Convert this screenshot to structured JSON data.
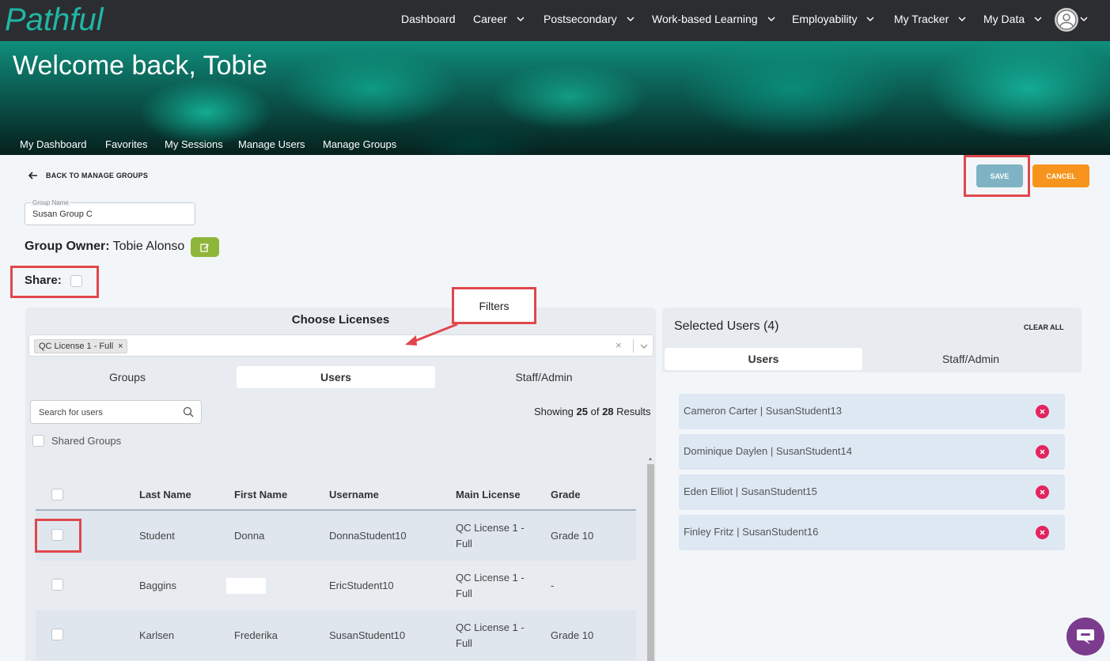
{
  "brand": {
    "logo_text": "Pathful",
    "logo_color": "#1fb7a4"
  },
  "topnav": {
    "items": [
      {
        "label": "Dashboard",
        "has_menu": false
      },
      {
        "label": "Career",
        "has_menu": true
      },
      {
        "label": "Postsecondary",
        "has_menu": true
      },
      {
        "label": "Work-based Learning",
        "has_menu": true
      },
      {
        "label": "Employability",
        "has_menu": true
      },
      {
        "label": "My Tracker",
        "has_menu": true
      },
      {
        "label": "My Data",
        "has_menu": true
      }
    ]
  },
  "hero": {
    "title": "Welcome back, Tobie"
  },
  "subnav": {
    "items": [
      "My Dashboard",
      "Favorites",
      "My Sessions",
      "Manage Users",
      "Manage Groups"
    ]
  },
  "actions": {
    "back_label": "BACK TO MANAGE GROUPS",
    "save_label": "SAVE",
    "cancel_label": "CANCEL"
  },
  "group": {
    "name_label": "Group Name",
    "name_value": "Susan Group C",
    "owner_label": "Group Owner:",
    "owner_value": "Tobie Alonso",
    "share_label": "Share:"
  },
  "licenses": {
    "title": "Choose Licenses",
    "selected_chip": "QC License 1 - Full",
    "tabs": [
      "Groups",
      "Users",
      "Staff/Admin"
    ],
    "active_tab": "Users",
    "search_placeholder": "Search for users",
    "showing_prefix": "Showing",
    "showing_count": "25",
    "showing_of": "of",
    "showing_total": "28",
    "showing_suffix": "Results",
    "shared_groups_label": "Shared Groups",
    "columns": [
      "Last Name",
      "First Name",
      "Username",
      "Main License",
      "Grade"
    ],
    "rows": [
      {
        "last": "Student",
        "first": "Donna",
        "username": "DonnaStudent10",
        "license_l1": "QC License 1 -",
        "license_l2": "Full",
        "grade": "Grade 10"
      },
      {
        "last": "Baggins",
        "first": "",
        "username": "EricStudent10",
        "license_l1": "QC License 1 -",
        "license_l2": "Full",
        "grade": "-"
      },
      {
        "last": "Karlsen",
        "first": "Frederika",
        "username": "SusanStudent10",
        "license_l1": "QC License 1 -",
        "license_l2": "Full",
        "grade": "Grade 10"
      }
    ]
  },
  "selected": {
    "title": "Selected Users (4)",
    "clear_all": "CLEAR ALL",
    "tabs": [
      "Users",
      "Staff/Admin"
    ],
    "active_tab": "Users",
    "users": [
      "Cameron Carter | SusanStudent13",
      "Dominique Daylen | SusanStudent14",
      "Eden Elliot | SusanStudent15",
      "Finley Fritz | SusanStudent16"
    ]
  },
  "annotation": {
    "callout_label": "Filters",
    "highlight_color": "#e0474c"
  },
  "colors": {
    "save": "#7fb3c4",
    "cancel": "#f7941d",
    "edit": "#8fb53a",
    "remove": "#e4245e",
    "chat": "#7c3c8e"
  }
}
